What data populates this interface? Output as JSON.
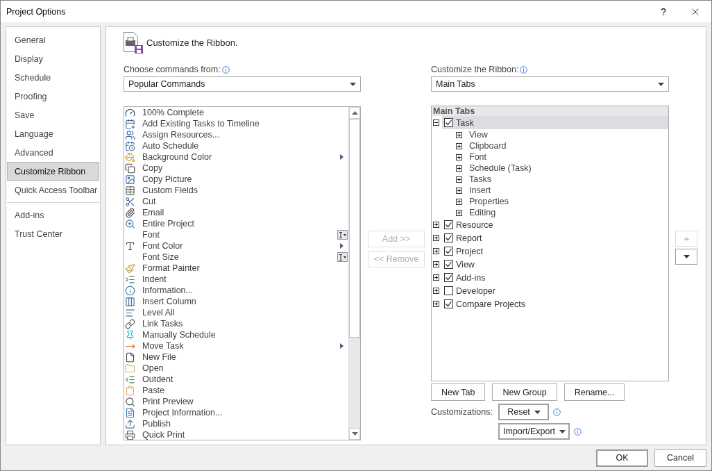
{
  "window": {
    "title": "Project Options",
    "help_button": "?"
  },
  "sidebar": {
    "sections": [
      {
        "items": [
          {
            "label": "General",
            "selected": false
          },
          {
            "label": "Display",
            "selected": false
          },
          {
            "label": "Schedule",
            "selected": false
          },
          {
            "label": "Proofing",
            "selected": false
          },
          {
            "label": "Save",
            "selected": false
          },
          {
            "label": "Language",
            "selected": false
          },
          {
            "label": "Advanced",
            "selected": false
          },
          {
            "label": "Customize Ribbon",
            "selected": true
          },
          {
            "label": "Quick Access Toolbar",
            "selected": false
          }
        ]
      },
      {
        "items": [
          {
            "label": "Add-ins",
            "selected": false
          },
          {
            "label": "Trust Center",
            "selected": false
          }
        ]
      }
    ]
  },
  "page": {
    "title": "Customize the Ribbon."
  },
  "commands": {
    "label": "Choose commands from:",
    "dropdown": "Popular Commands",
    "items": [
      {
        "label": "100% Complete",
        "kind": "plain"
      },
      {
        "label": "Add Existing Tasks to Timeline",
        "kind": "plain"
      },
      {
        "label": "Assign Resources...",
        "kind": "plain"
      },
      {
        "label": "Auto Schedule",
        "kind": "plain"
      },
      {
        "label": "Background Color",
        "kind": "submenu"
      },
      {
        "label": "Copy",
        "kind": "plain"
      },
      {
        "label": "Copy Picture",
        "kind": "plain"
      },
      {
        "label": "Custom Fields",
        "kind": "plain"
      },
      {
        "label": "Cut",
        "kind": "plain"
      },
      {
        "label": "Email",
        "kind": "plain"
      },
      {
        "label": "Entire Project",
        "kind": "plain"
      },
      {
        "label": "Font",
        "kind": "picker"
      },
      {
        "label": "Font Color",
        "kind": "submenu"
      },
      {
        "label": "Font Size",
        "kind": "picker"
      },
      {
        "label": "Format Painter",
        "kind": "plain"
      },
      {
        "label": "Indent",
        "kind": "plain"
      },
      {
        "label": "Information...",
        "kind": "plain"
      },
      {
        "label": "Insert Column",
        "kind": "plain"
      },
      {
        "label": "Level All",
        "kind": "plain"
      },
      {
        "label": "Link Tasks",
        "kind": "plain"
      },
      {
        "label": "Manually Schedule",
        "kind": "plain"
      },
      {
        "label": "Move Task",
        "kind": "submenu"
      },
      {
        "label": "New File",
        "kind": "plain"
      },
      {
        "label": "Open",
        "kind": "plain"
      },
      {
        "label": "Outdent",
        "kind": "plain"
      },
      {
        "label": "Paste",
        "kind": "plain"
      },
      {
        "label": "Print Preview",
        "kind": "plain"
      },
      {
        "label": "Project Information...",
        "kind": "plain"
      },
      {
        "label": "Publish",
        "kind": "plain"
      },
      {
        "label": "Quick Print",
        "kind": "plain"
      }
    ]
  },
  "transfer_buttons": [
    {
      "label": "Add >>",
      "disabled": true
    },
    {
      "label": "<< Remove",
      "disabled": true
    }
  ],
  "ribbon": {
    "label": "Customize the Ribbon:",
    "dropdown": "Main Tabs",
    "tree": {
      "header": "Main Tabs",
      "tabs": [
        {
          "label": "Task",
          "checked": true,
          "expanded": true,
          "selected": true,
          "children": [
            {
              "label": "View"
            },
            {
              "label": "Clipboard"
            },
            {
              "label": "Font"
            },
            {
              "label": "Schedule (Task)"
            },
            {
              "label": "Tasks"
            },
            {
              "label": "Insert"
            },
            {
              "label": "Properties"
            },
            {
              "label": "Editing"
            }
          ]
        },
        {
          "label": "Resource",
          "checked": true,
          "expanded": false,
          "selected": false
        },
        {
          "label": "Report",
          "checked": true,
          "expanded": false,
          "selected": false
        },
        {
          "label": "Project",
          "checked": true,
          "expanded": false,
          "selected": false
        },
        {
          "label": "View",
          "checked": true,
          "expanded": false,
          "selected": false
        },
        {
          "label": "Add-ins",
          "checked": true,
          "expanded": false,
          "selected": false
        },
        {
          "label": "Developer",
          "checked": false,
          "expanded": false,
          "selected": false
        },
        {
          "label": "Compare Projects",
          "checked": true,
          "expanded": false,
          "selected": false
        }
      ]
    }
  },
  "ribbon_buttons": [
    "New Tab",
    "New Group",
    "Rename..."
  ],
  "customizations": {
    "label": "Customizations:",
    "reset": "Reset",
    "import_export": "Import/Export"
  },
  "move_buttons": [
    {
      "kind": "up",
      "disabled": true
    },
    {
      "kind": "down",
      "disabled": false
    }
  ],
  "footer_buttons": [
    {
      "label": "OK",
      "default": true
    },
    {
      "label": "Cancel",
      "default": false
    }
  ]
}
